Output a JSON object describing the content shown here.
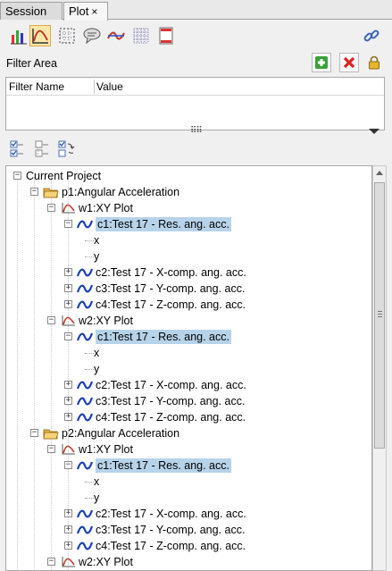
{
  "tabs": [
    {
      "label": "Session"
    },
    {
      "label": "Plot",
      "close": "×"
    }
  ],
  "filter": {
    "title": "Filter Area",
    "columns": [
      "Filter Name",
      "Value"
    ],
    "more": "⠿⠿"
  },
  "tree": {
    "root": "Current Project",
    "pages": [
      {
        "label": "p1:Angular Acceleration",
        "windows": [
          {
            "label": "w1:XY Plot",
            "curves": [
              {
                "label": "c1:Test 17 - Res. ang. acc.",
                "children": [
                  "x",
                  "y"
                ]
              },
              {
                "label": "c2:Test 17 - X-comp. ang. acc."
              },
              {
                "label": "c3:Test 17 - Y-comp. ang. acc."
              },
              {
                "label": "c4:Test 17 - Z-comp. ang. acc."
              }
            ]
          },
          {
            "label": "w2:XY Plot",
            "curves": [
              {
                "label": "c1:Test 17 - Res. ang. acc.",
                "children": [
                  "x",
                  "y"
                ]
              },
              {
                "label": "c2:Test 17 - X-comp. ang. acc."
              },
              {
                "label": "c3:Test 17 - Y-comp. ang. acc."
              },
              {
                "label": "c4:Test 17 - Z-comp. ang. acc."
              }
            ]
          }
        ]
      },
      {
        "label": "p2:Angular Acceleration",
        "windows": [
          {
            "label": "w1:XY Plot",
            "curves": [
              {
                "label": "c1:Test 17 - Res. ang. acc.",
                "children": [
                  "x",
                  "y"
                ]
              },
              {
                "label": "c2:Test 17 - X-comp. ang. acc."
              },
              {
                "label": "c3:Test 17 - Y-comp. ang. acc."
              },
              {
                "label": "c4:Test 17 - Z-comp. ang. acc."
              }
            ]
          },
          {
            "label": "w2:XY Plot",
            "curves": []
          }
        ]
      }
    ]
  },
  "colors": {
    "accent": "#b7d3ea",
    "curve": "#1a3fb5",
    "plot_icon": "#c0392b",
    "folder": "#e8b04a"
  }
}
